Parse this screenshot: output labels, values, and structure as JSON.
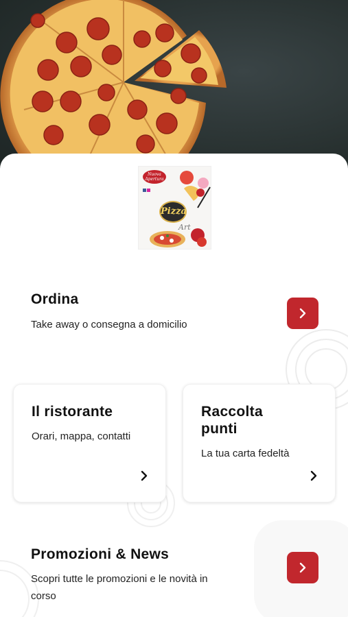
{
  "logo": {
    "badge_text": "Nuova Apertura",
    "word": "Pizza",
    "art": "Art"
  },
  "order": {
    "title": "Ordina",
    "subtitle": "Take away o consegna a domicilio",
    "icon": "chevron-right-icon"
  },
  "restaurant": {
    "title": "Il ristorante",
    "subtitle": "Orari, mappa, contatti",
    "icon": "chevron-right-icon"
  },
  "points": {
    "title_line1": "Raccolta",
    "title_line2": "punti",
    "subtitle": "La tua carta fedeltà",
    "icon": "chevron-right-icon"
  },
  "promo": {
    "title": "Promozioni & News",
    "subtitle_line1": "Scopri tutte le promozioni e le novità in",
    "subtitle_line2": "corso",
    "icon": "chevron-right-icon"
  },
  "colors": {
    "accent": "#c1272d",
    "hero_bg": "#27302f"
  }
}
